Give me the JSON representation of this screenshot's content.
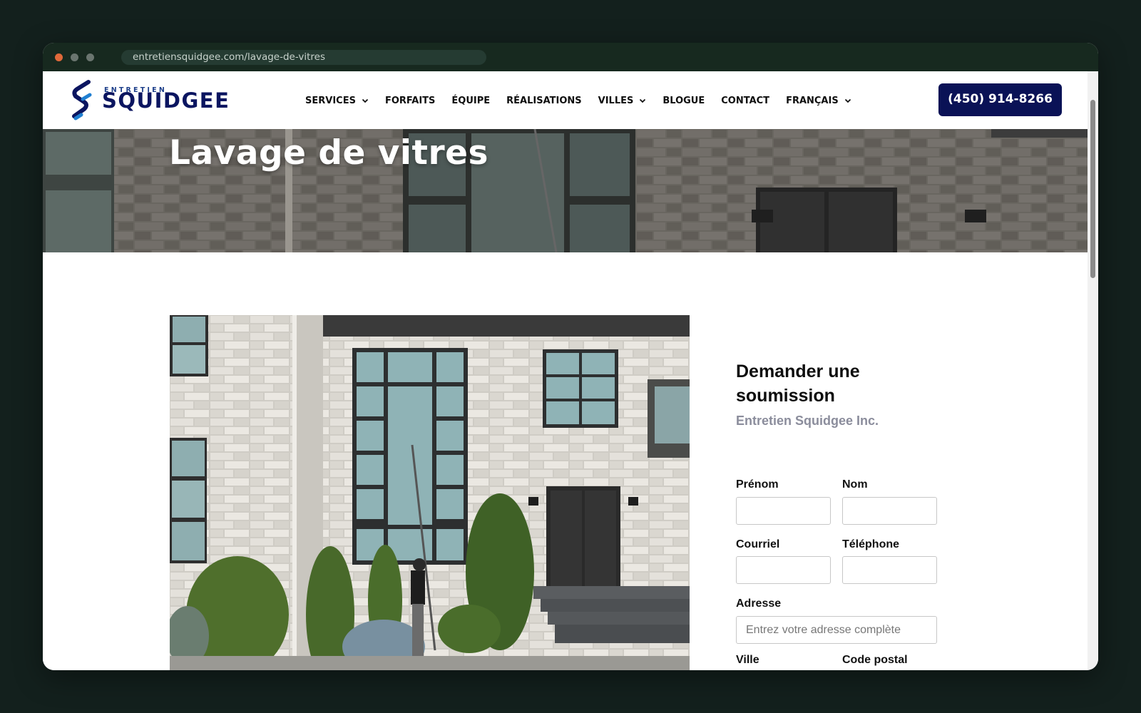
{
  "browser": {
    "url": "entretiensquidgee.com/lavage-de-vitres"
  },
  "header": {
    "logo_small": "ENTRETIEN",
    "logo_big": "SQUIDGEE",
    "nav": [
      {
        "label": "SERVICES",
        "dropdown": true
      },
      {
        "label": "FORFAITS",
        "dropdown": false
      },
      {
        "label": "ÉQUIPE",
        "dropdown": false
      },
      {
        "label": "RÉALISATIONS",
        "dropdown": false
      },
      {
        "label": "VILLES",
        "dropdown": true
      },
      {
        "label": "BLOGUE",
        "dropdown": false
      },
      {
        "label": "CONTACT",
        "dropdown": false
      },
      {
        "label": "FRANÇAIS",
        "dropdown": true
      }
    ],
    "phone": "(450) 914-8266"
  },
  "hero": {
    "title": "Lavage de vitres"
  },
  "form": {
    "title": "Demander une soumission",
    "subtitle": "Entretien Squidgee Inc.",
    "fields": {
      "first_name": {
        "label": "Prénom",
        "value": "",
        "placeholder": ""
      },
      "last_name": {
        "label": "Nom",
        "value": "",
        "placeholder": ""
      },
      "email": {
        "label": "Courriel",
        "value": "",
        "placeholder": ""
      },
      "phone": {
        "label": "Téléphone",
        "value": "",
        "placeholder": ""
      },
      "address": {
        "label": "Adresse",
        "value": "",
        "placeholder": "Entrez votre adresse complète"
      },
      "city": {
        "label": "Ville",
        "value": "",
        "placeholder": ""
      },
      "postal": {
        "label": "Code postal",
        "value": "",
        "placeholder": ""
      }
    }
  },
  "colors": {
    "brand_navy": "#0a1256",
    "brand_blue": "#1d3f8a",
    "page_background": "#13201d"
  }
}
